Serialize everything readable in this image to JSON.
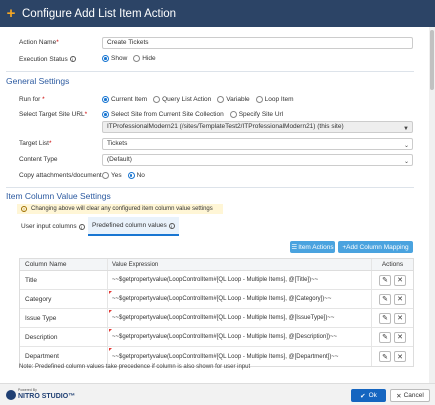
{
  "header": {
    "title": "Configure Add List Item Action",
    "icon": "plus-icon"
  },
  "action_name": {
    "label": "Action Name",
    "value": "Create Tickets"
  },
  "execution_status": {
    "label": "Execution Status",
    "options": [
      "Show",
      "Hide"
    ],
    "selected": "Show"
  },
  "general_settings": {
    "title": "General Settings"
  },
  "run_for": {
    "label": "Run for",
    "options": [
      "Current Item",
      "Query List Action",
      "Variable",
      "Loop Item"
    ],
    "selected": "Current Item"
  },
  "target_site": {
    "label": "Select Target Site URL",
    "options": [
      "Select Site from Current Site Collection",
      "Specify Site Url"
    ],
    "selected": "Select Site from Current Site Collection",
    "value": "ITProfessionalModern21 (/sites/TemplateTest2/ITProfessionalModern21) (this site)"
  },
  "target_list": {
    "label": "Target List",
    "value": "Tickets"
  },
  "content_type": {
    "label": "Content Type",
    "value": "(Default)"
  },
  "copy_attachments": {
    "label": "Copy attachments/document",
    "options": [
      "Yes",
      "No"
    ],
    "selected": "No"
  },
  "column_settings": {
    "title": "Item Column Value Settings",
    "warning": "Changing above will clear any configured item column value settings",
    "tabs": [
      "User input columns",
      "Predefined column values"
    ],
    "active_tab": "Predefined column values",
    "item_actions_label": "Item Actions",
    "add_mapping_label": "+Add Column Mapping"
  },
  "table": {
    "headers": [
      "Column Name",
      "Value Expression",
      "Actions"
    ],
    "rows": [
      {
        "name": "Title",
        "expr": "~~$getpropertyvalue(LoopControlItem#[QL Loop - Multiple Items], @[Title])~~"
      },
      {
        "name": "Category",
        "expr": "~~$getpropertyvalue(LoopControlItem#[QL Loop - Multiple Items], @[Category])~~"
      },
      {
        "name": "Issue Type",
        "expr": "~~$getpropertyvalue(LoopControlItem#[QL Loop - Multiple Items], @[IssueType])~~"
      },
      {
        "name": "Description",
        "expr": "~~$getpropertyvalue(LoopControlItem#[QL Loop - Multiple Items], @[Description])~~"
      },
      {
        "name": "Department",
        "expr": "~~$getpropertyvalue(LoopControlItem#[QL Loop - Multiple Items], @[Department])~~"
      }
    ]
  },
  "note": "Note: Predefined column values take precedence if column is also shown for user input",
  "footer": {
    "powered_by": "Powered By",
    "brand": "NITRO STUDIO™",
    "ok_label": "Ok",
    "cancel_label": "Cancel"
  },
  "colors": {
    "header_bg": "#2c4466",
    "accent": "#1976d2",
    "primary_button": "#1565c0",
    "section_title": "#2c5aa0"
  }
}
